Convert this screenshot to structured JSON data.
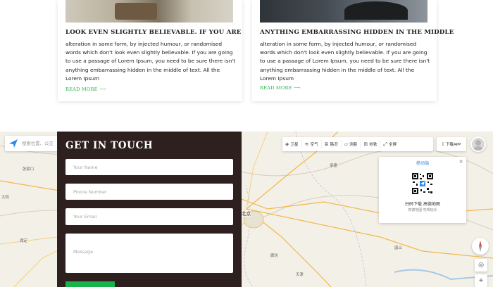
{
  "blog": {
    "posts": [
      {
        "title": "LOOK EVEN SLIGHTLY BELIEVABLE. IF YOU ARE",
        "excerpt": "alteration in some form, by injected humour, or randomised words which don't look even slightly believable. If you are going to use a passage of Lorem Ipsum, you need to be sure there isn't anything embarrassing hidden in the middle of text. All the Lorem Ipsum",
        "read_more": "READ MORE ⟶"
      },
      {
        "title": "ANYTHING EMBARRASSING HIDDEN IN THE MIDDLE",
        "excerpt": "alteration in some form, by injected humour, or randomised words which don't look even slightly believable. If you are going to use a passage of Lorem Ipsum, you need to be sure there isn't anything embarrassing hidden in the middle of text. All the Lorem Ipsum",
        "read_more": "READ MORE ⟶"
      }
    ],
    "accent_color": "#2fb24a"
  },
  "contact": {
    "title": "GET IN TOUCH",
    "name_placeholder": "Your Name",
    "phone_placeholder": "Phone Number",
    "email_placeholder": "Your Email",
    "message_placeholder": "Message",
    "submit_label": "",
    "panel_color": "#2d201e",
    "button_color": "#19b24b"
  },
  "map": {
    "search_placeholder": "搜索位置、公交",
    "tools": [
      {
        "icon": "satellite-icon",
        "glyph": "◈",
        "label": "卫星"
      },
      {
        "icon": "air-icon",
        "glyph": "≋",
        "label": "空气"
      },
      {
        "icon": "layers-icon",
        "glyph": "≣",
        "label": "路况"
      },
      {
        "icon": "ruler-icon",
        "glyph": "▱",
        "label": "测距"
      },
      {
        "icon": "subway-icon",
        "glyph": "⊞",
        "label": "地铁"
      },
      {
        "icon": "fullscreen-icon",
        "glyph": "⤢",
        "label": "全屏"
      }
    ],
    "download_app": "下载APP",
    "qr_panel": {
      "title": "移动端",
      "line1": "扫码下载 高德地图",
      "line2": "高德地图 吃喝玩乐"
    },
    "cities": [
      {
        "name": "北京",
        "big": true
      },
      {
        "name": "大同",
        "big": false
      },
      {
        "name": "廊坊",
        "big": false
      },
      {
        "name": "唐山",
        "big": false
      },
      {
        "name": "张家口",
        "big": false
      },
      {
        "name": "承德",
        "big": false
      },
      {
        "name": "保定",
        "big": false
      },
      {
        "name": "天津",
        "big": false
      }
    ]
  }
}
